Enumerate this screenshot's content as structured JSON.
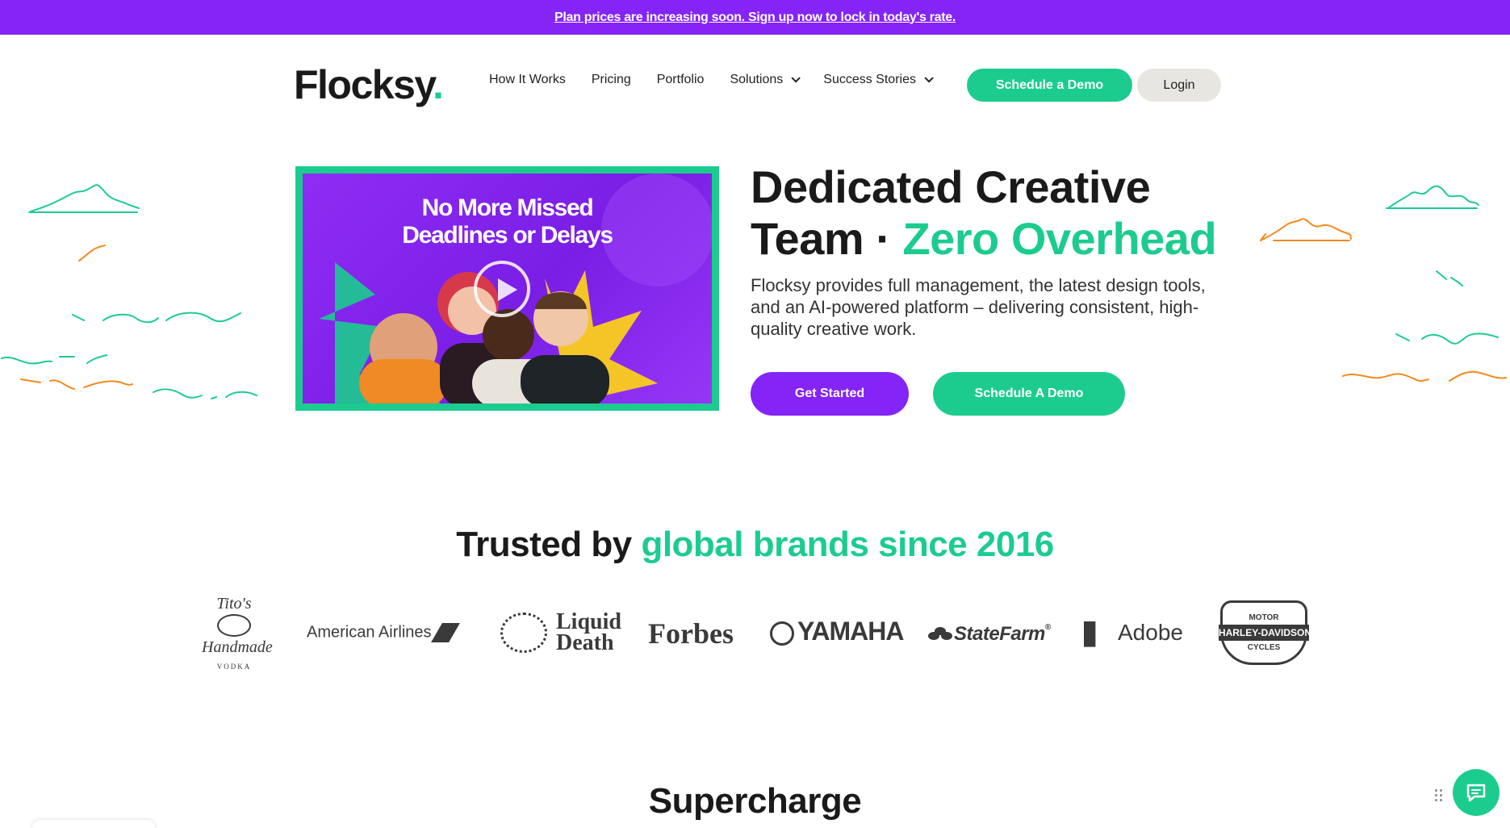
{
  "banner": {
    "text": "Plan prices are increasing soon. Sign up now to lock in today's rate."
  },
  "header": {
    "logo": "Flocksy",
    "logo_dot": ".",
    "nav": [
      "How It Works",
      "Pricing",
      "Portfolio",
      "Solutions",
      "Success Stories"
    ],
    "schedule_demo": "Schedule a Demo",
    "login": "Login"
  },
  "hero": {
    "video_title_line1": "No More Missed",
    "video_title_line2": "Deadlines or Delays",
    "title_line1": "Dedicated Creative",
    "title_line2_a": "Team",
    "title_sep": " · ",
    "title_line2_b": "Zero Overhead",
    "description": "Flocksy provides full management, the latest design tools, and an AI-powered platform – delivering consistent, high-quality creative work.",
    "get_started": "Get Started",
    "schedule_demo": "Schedule A Demo"
  },
  "trusted": {
    "prefix": "Trusted by ",
    "highlight": "global brands since 2016"
  },
  "brands": {
    "titos_line1": "Tito's",
    "titos_line2": "Handmade",
    "titos_line3": "VODKA",
    "american_airlines": "American Airlines",
    "liquid_death_line1": "Liquid",
    "liquid_death_line2": "Death",
    "forbes": "Forbes",
    "yamaha": "YAMAHA",
    "state_farm": "StateFarm",
    "state_farm_mark": "®",
    "adobe": "Adobe",
    "harley_top": "MOTOR",
    "harley_mid": "HARLEY-DAVIDSON",
    "harley_bottom": "CYCLES"
  },
  "section": {
    "supercharge": "Supercharge"
  },
  "colors": {
    "purple": "#8424f6",
    "green": "#1ccc8e",
    "orange": "#f28a1e",
    "gray_button": "#e8e6e0"
  },
  "icons": {
    "chat": "chat-bubble-icon",
    "play": "play-icon",
    "chevron": "chevron-down-icon"
  }
}
